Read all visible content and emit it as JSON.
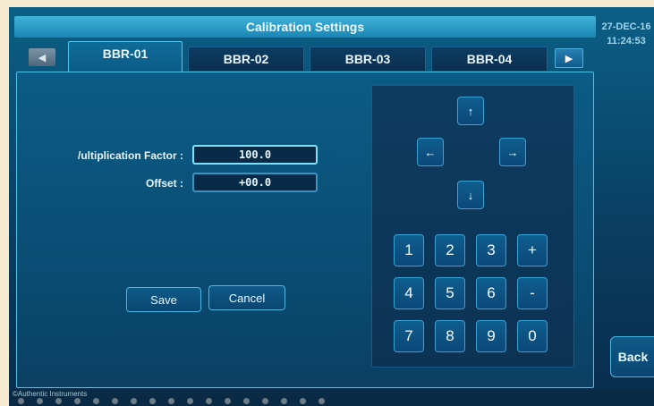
{
  "title": "Calibration Settings",
  "datetime": {
    "date": "27-DEC-16",
    "time": "11:24:53"
  },
  "tabs": [
    {
      "label": "BBR-01",
      "active": true
    },
    {
      "label": "BBR-02",
      "active": false
    },
    {
      "label": "BBR-03",
      "active": false
    },
    {
      "label": "BBR-04",
      "active": false
    }
  ],
  "nav": {
    "prev": "◀",
    "next": "▶"
  },
  "form": {
    "multiplication_label": "/ultiplication Factor :",
    "multiplication_value": "100.0",
    "offset_label": "Offset :",
    "offset_value": "+00.0"
  },
  "actions": {
    "save": "Save",
    "cancel": "Cancel",
    "back": "Back"
  },
  "arrows": {
    "up": "↑",
    "left": "←",
    "right": "→",
    "down": "↓"
  },
  "keypad": {
    "k1": "1",
    "k2": "2",
    "k3": "3",
    "plus": "+",
    "k4": "4",
    "k5": "5",
    "k6": "6",
    "minus": "-",
    "k7": "7",
    "k8": "8",
    "k9": "9",
    "k0": "0"
  },
  "footer": {
    "copyright": "©Authentic Instruments"
  },
  "colors": {
    "accent": "#4fc3ea",
    "background": "#0a4d74",
    "title_bar": "#2a9cc8"
  }
}
